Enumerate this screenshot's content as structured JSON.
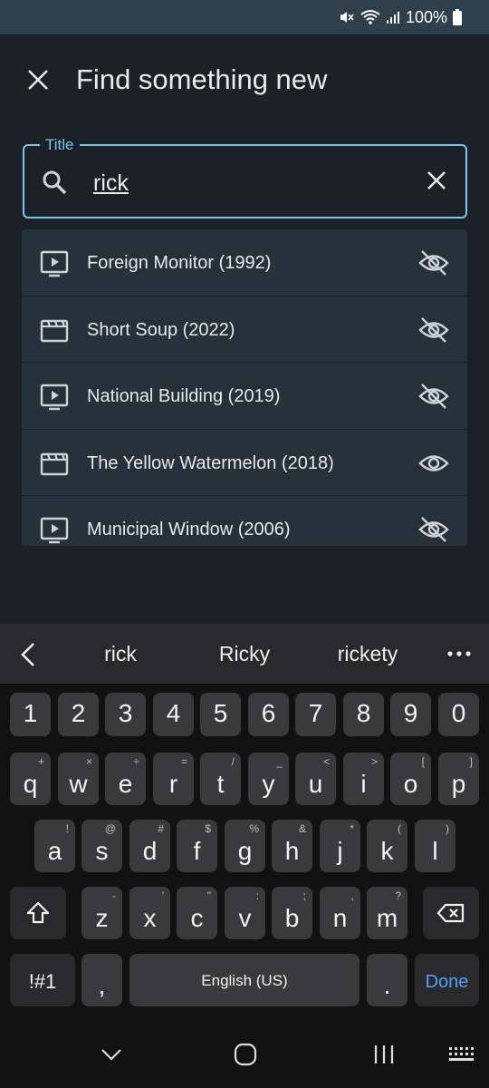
{
  "status_bar": {
    "battery": "100%"
  },
  "app_bar": {
    "title": "Find something new"
  },
  "search": {
    "label": "Title",
    "value": "rick"
  },
  "results": [
    {
      "title": "Foreign Monitor (1992)",
      "type": "tv",
      "watched": false
    },
    {
      "title": "Short Soup (2022)",
      "type": "movie",
      "watched": false
    },
    {
      "title": "National Building (2019)",
      "type": "tv",
      "watched": false
    },
    {
      "title": "The Yellow Watermelon (2018)",
      "type": "movie",
      "watched": true
    },
    {
      "title": "Municipal Window (2006)",
      "type": "tv",
      "watched": false
    }
  ],
  "keyboard": {
    "suggestions": [
      "rick",
      "Ricky",
      "rickety"
    ],
    "number_row": [
      "1",
      "2",
      "3",
      "4",
      "5",
      "6",
      "7",
      "8",
      "9",
      "0"
    ],
    "row1": [
      [
        "q",
        "+"
      ],
      [
        "w",
        "×"
      ],
      [
        "e",
        "÷"
      ],
      [
        "r",
        "="
      ],
      [
        "t",
        "/"
      ],
      [
        "y",
        "_"
      ],
      [
        "u",
        "<"
      ],
      [
        "i",
        ">"
      ],
      [
        "o",
        "["
      ],
      [
        "p",
        "]"
      ]
    ],
    "row2": [
      [
        "a",
        "!"
      ],
      [
        "s",
        "@"
      ],
      [
        "d",
        "#"
      ],
      [
        "f",
        "$"
      ],
      [
        "g",
        "%"
      ],
      [
        "h",
        "&"
      ],
      [
        "j",
        "*"
      ],
      [
        "k",
        "("
      ],
      [
        "l",
        ")"
      ]
    ],
    "row3": [
      [
        "z",
        "-"
      ],
      [
        "x",
        "'"
      ],
      [
        "c",
        "\""
      ],
      [
        "v",
        ":"
      ],
      [
        "b",
        ";"
      ],
      [
        "n",
        ","
      ],
      [
        "m",
        "?"
      ]
    ],
    "symbols_label": "!#1",
    "comma": ",",
    "space_label": "English (US)",
    "period": ".",
    "done_label": "Done"
  },
  "colors": {
    "accent": "#7ec3ec",
    "surface": "#27313a",
    "background": "#1b2127",
    "done": "#4aa3ff"
  }
}
